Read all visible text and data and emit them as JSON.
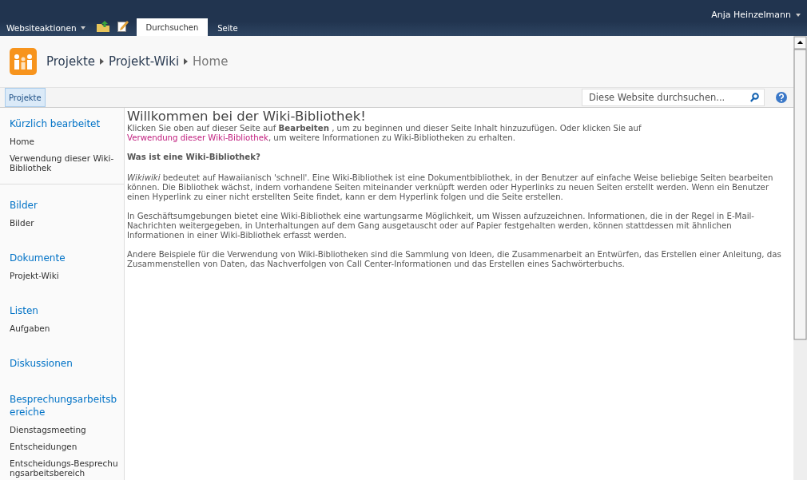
{
  "top_bar": {
    "site_actions": "Websiteaktionen",
    "tabs": [
      {
        "label": "Durchsuchen",
        "selected": true
      },
      {
        "label": "Seite",
        "selected": false
      }
    ],
    "user": "Anja Heinzelmann"
  },
  "breadcrumb": [
    "Projekte",
    "Projekt-Wiki",
    "Home"
  ],
  "nav_bar": {
    "tabs": [
      {
        "label": "Projekte",
        "selected": true
      }
    ],
    "search": {
      "placeholder": "Diese Website durchsuchen..."
    }
  },
  "sidebar": {
    "recent": {
      "heading": "Kürzlich bearbeitet",
      "items": [
        "Home",
        "Verwendung dieser Wiki-Bibliothek"
      ]
    },
    "groups": [
      {
        "heading": "Bilder",
        "items": [
          "Bilder"
        ]
      },
      {
        "heading": "Dokumente",
        "items": [
          "Projekt-Wiki"
        ]
      },
      {
        "heading": "Listen",
        "items": [
          "Aufgaben"
        ]
      },
      {
        "heading": "Diskussionen"
      },
      {
        "heading": "Besprechungsarbeitsbereiche",
        "items": [
          "Dienstagsmeeting",
          "Entscheidungen",
          "Entscheidungs-Besprechungsarbeitsbereich"
        ]
      }
    ]
  },
  "content": {
    "title": "Willkommen bei der Wiki-Bibliothek!",
    "intro": {
      "before": "Klicken Sie oben auf dieser Seite auf **Bearbeiten** , um zu beginnen und dieser Seite Inhalt hinzuzufügen. Oder klicken Sie auf ",
      "link": "Verwendung dieser Wiki-Bibliothek",
      "after": ", um weitere Informationen zu Wiki-Bibliotheken zu erhalten."
    },
    "subheading": "Was ist eine Wiki-Bibliothek?",
    "paragraphs": [
      "*Wikiwiki* bedeutet auf Hawaiianisch 'schnell'. Eine Wiki-Bibliothek ist eine Dokumentbibliothek, in der Benutzer auf einfache Weise beliebige Seiten bearbeiten können. Die Bibliothek wächst, indem vorhandene Seiten miteinander verknüpft werden oder Hyperlinks zu neuen Seiten erstellt werden. Wenn ein Benutzer einen Hyperlink zu einer nicht erstellten Seite findet, kann er dem Hyperlink folgen und die Seite erstellen.",
      "In Geschäftsumgebungen bietet eine Wiki-Bibliothek eine wartungsarme Möglichkeit, um Wissen aufzuzeichnen. Informationen, die in der Regel in E-Mail-Nachrichten weitergegeben, in Unterhaltungen auf dem Gang ausgetauscht oder auf Papier festgehalten werden, können stattdessen mit ähnlichen Informationen in einer Wiki-Bibliothek erfasst werden.",
      "Andere Beispiele für die Verwendung von Wiki-Bibliotheken sind die Sammlung von Ideen, die Zusammenarbeit an Entwürfen, das Erstellen einer Anleitung, das Zusammenstellen von Daten, das Nachverfolgen von Call Center-Informationen und das Erstellen eines Sachwörterbuchs."
    ]
  }
}
